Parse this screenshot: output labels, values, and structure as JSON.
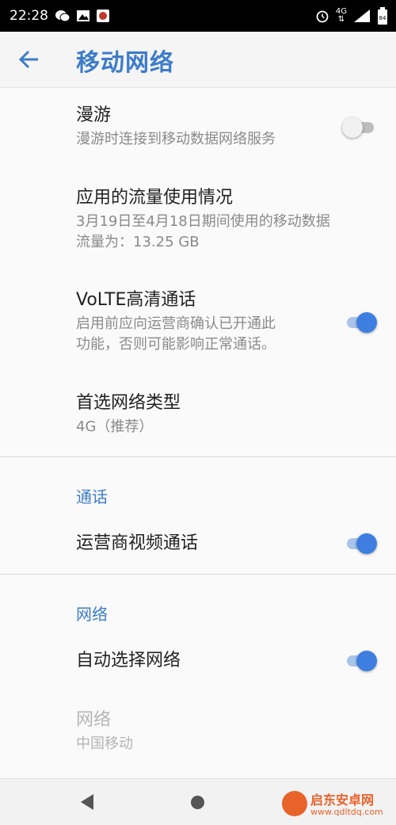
{
  "status_bar": {
    "time": "22:28",
    "network": "4G",
    "battery": "84",
    "left_icons": [
      "wechat-icon",
      "gallery-icon",
      "app-icon"
    ],
    "right_icons": [
      "alarm-icon",
      "signal-icon",
      "battery-icon"
    ]
  },
  "app_bar": {
    "title": "移动网络",
    "back_icon": "arrow-back-icon",
    "accent_color": "#3d7cc9"
  },
  "settings": {
    "roaming": {
      "title": "漫游",
      "subtitle": "漫游时连接到移动数据网络服务",
      "enabled": false
    },
    "data_usage": {
      "title": "应用的流量使用情况",
      "subtitle_line1": "3月19日至4月18日期间使用的移动数据",
      "subtitle_line2": "流量为：13.25 GB"
    },
    "volte": {
      "title": "VoLTE高清通话",
      "subtitle_line1": "启用前应向运营商确认已开通此",
      "subtitle_line2": "功能，否则可能影响正常通话。",
      "enabled": true
    },
    "preferred_network": {
      "title": "首选网络类型",
      "subtitle": "4G（推荐）"
    }
  },
  "sections": {
    "calls": {
      "header": "通话",
      "video_call": {
        "title": "运营商视频通话",
        "enabled": true
      }
    },
    "network": {
      "header": "网络",
      "auto_select": {
        "title": "自动选择网络",
        "enabled": true
      },
      "network_item": {
        "title": "网络",
        "subtitle": "中国移动",
        "disabled": true
      }
    }
  },
  "watermark": {
    "title": "启东安卓网",
    "url": "www.qdltdq.com"
  }
}
